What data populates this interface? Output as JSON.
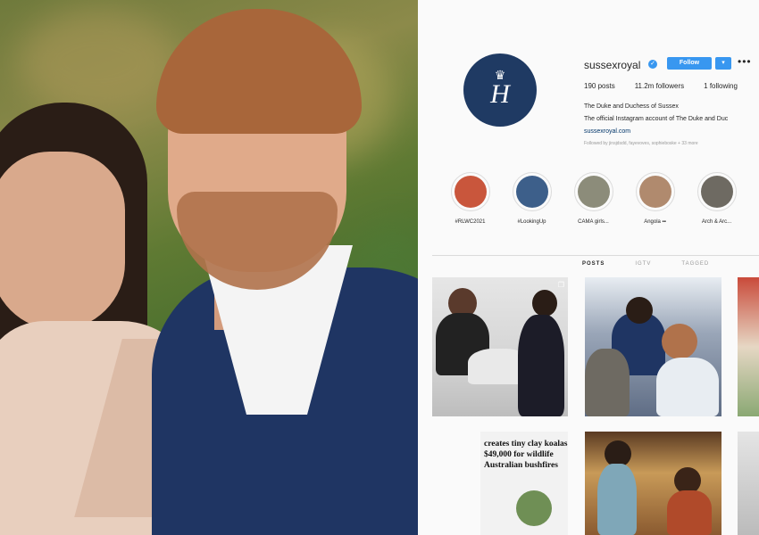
{
  "profile": {
    "username": "sussexroyal",
    "follow_label": "Follow",
    "more_label": "▾",
    "options_label": "•••",
    "verified_mark": "✓",
    "avatar_crown": "♛",
    "avatar_monogram": "H",
    "stats": {
      "posts": "190 posts",
      "followers": "11.2m followers",
      "following": "1 following"
    },
    "bio_name": "The Duke and Duchess of Sussex",
    "bio_text": "The official Instagram account of The Duke and Duc",
    "bio_link": "sussexroyal.com",
    "followed_by": "Followed by jinsjdsdd, fayevoves, sophieboske + 33 more"
  },
  "highlights": [
    {
      "label": "#RLWC2021",
      "color": "#c9563c"
    },
    {
      "label": "#LookingUp",
      "color": "#3d5f8a"
    },
    {
      "label": "CAMA girls...",
      "color": "#8c8c7a"
    },
    {
      "label": "Angola ▪▪",
      "color": "#b08a6e"
    },
    {
      "label": "Arch & Arc...",
      "color": "#6e6a62"
    }
  ],
  "tabs": [
    "POSTS",
    "IGTV",
    "TAGGED"
  ],
  "posts": {
    "headline_lines": [
      "creates tiny clay koalas",
      "$49,000 for wildlife",
      "Australian bushfires"
    ]
  },
  "colors": {
    "accent": "#3897f0",
    "avatar_bg": "#1f3a63",
    "jacket": "#1f3563"
  }
}
